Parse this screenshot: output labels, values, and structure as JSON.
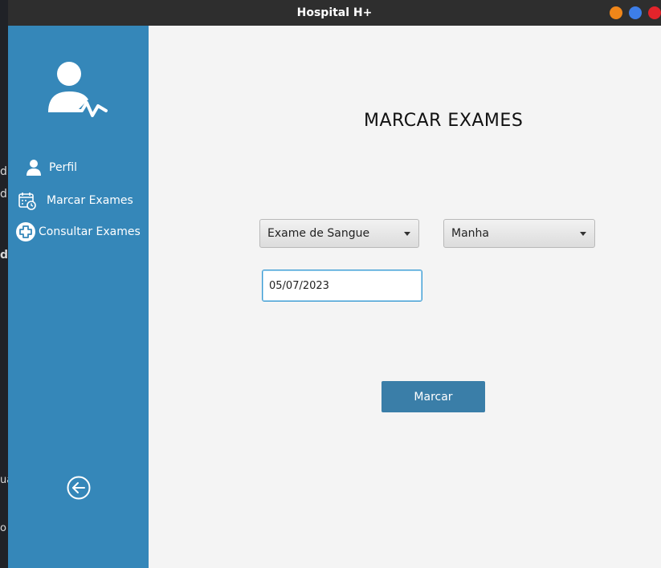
{
  "window": {
    "title": "Hospital H+"
  },
  "background": {
    "fragments": [
      "d",
      "du",
      "do",
      "ua",
      "o a"
    ]
  },
  "sidebar": {
    "items": [
      {
        "label": "Perfil",
        "icon": "user-icon"
      },
      {
        "label": "Marcar Exames",
        "icon": "calendar-clock-icon"
      },
      {
        "label": "Consultar Exames",
        "icon": "plus-circle-icon"
      }
    ],
    "back_icon": "arrow-left-circle-icon",
    "logo_icon": "doctor-heartbeat-icon"
  },
  "main": {
    "title": "MARCAR EXAMES",
    "exam_select": {
      "value": "Exame de Sangue"
    },
    "period_select": {
      "value": "Manha"
    },
    "date_input": {
      "value": "05/07/2023"
    },
    "submit_label": "Marcar"
  },
  "colors": {
    "sidebar": "#3587b9",
    "button": "#3a7ea8",
    "content_bg": "#f4f4f4",
    "titlebar": "#2e2e2e"
  }
}
